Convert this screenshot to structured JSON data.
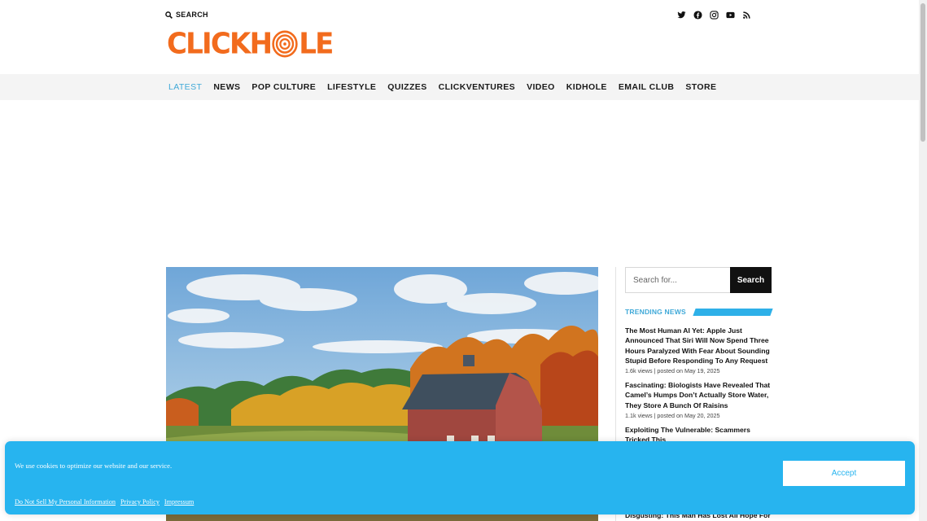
{
  "header": {
    "search_label": "SEARCH",
    "logo_left": "CLICKH",
    "logo_right": "LE",
    "brand_color": "#f26b1d",
    "social_icons": [
      "twitter-icon",
      "facebook-icon",
      "instagram-icon",
      "youtube-icon",
      "rss-icon"
    ]
  },
  "nav": {
    "items": [
      "LATEST",
      "NEWS",
      "POP CULTURE",
      "LIFESTYLE",
      "QUIZZES",
      "CLICKVENTURES",
      "VIDEO",
      "KIDHOLE",
      "EMAIL CLUB",
      "STORE"
    ],
    "active": "LATEST",
    "accent": "#3fa9d8"
  },
  "sidebar": {
    "search_placeholder": "Search for...",
    "search_button": "Search",
    "trending_label": "TRENDING NEWS",
    "trending": [
      {
        "title": "The Most Human AI Yet: Apple Just Announced That Siri Will Now Spend Three Hours Paralyzed With Fear About Sounding Stupid Before Responding To Any Request",
        "meta": "1.6k views | posted on May 19, 2025"
      },
      {
        "title": "Fascinating: Biologists Have Revealed That Camel’s Humps Don’t Actually Store Water, They Store A Bunch Of Raisins",
        "meta": "1.1k views | posted on May 20, 2025"
      },
      {
        "title": "Exploiting The Vulnerable: Scammers Tricked This",
        "meta": ""
      }
    ],
    "trending_partial": "Disgusting: This Man Has Lost All Hope For"
  },
  "cookie": {
    "message": "We use cookies to optimize our website and our service.",
    "accept": "Accept",
    "links": [
      "Do Not Sell My Personal Information",
      "Privacy Policy",
      "Impressum"
    ],
    "background": "#27b4ef"
  }
}
